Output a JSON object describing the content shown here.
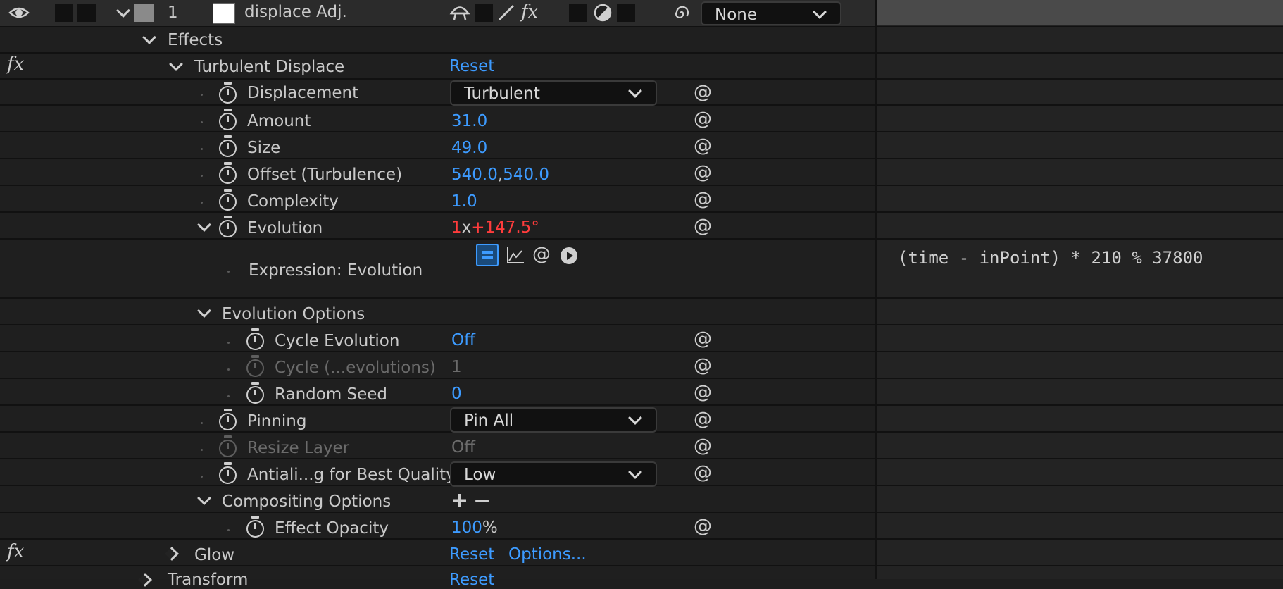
{
  "layer": {
    "number": "1",
    "name": "displace Adj.",
    "blend_mode": "None"
  },
  "effects_label": "Effects",
  "turbulent": {
    "name": "Turbulent Displace",
    "reset": "Reset"
  },
  "props": {
    "displacement": {
      "label": "Displacement",
      "value": "Turbulent"
    },
    "amount": {
      "label": "Amount",
      "value": "31.0"
    },
    "size": {
      "label": "Size",
      "value": "49.0"
    },
    "offset": {
      "label": "Offset (Turbulence)",
      "value_x": "540.0",
      "sep": ",",
      "value_y": "540.0"
    },
    "complexity": {
      "label": "Complexity",
      "value": "1.0"
    },
    "evolution": {
      "label": "Evolution",
      "revs": "1",
      "x": "x",
      "deg": "+147.5",
      "unit": "°"
    },
    "expression": {
      "label": "Expression: Evolution",
      "code": "(time - inPoint) * 210 % 37800"
    },
    "evolution_options": "Evolution Options",
    "cycle_evolution": {
      "label": "Cycle Evolution",
      "value": "Off"
    },
    "cycle_revs": {
      "label": "Cycle (...evolutions)",
      "value": "1"
    },
    "random_seed": {
      "label": "Random Seed",
      "value": "0"
    },
    "pinning": {
      "label": "Pinning",
      "value": "Pin All"
    },
    "resize_layer": {
      "label": "Resize Layer",
      "value": "Off"
    },
    "antialias": {
      "label": "Antiali...g for Best Quality",
      "value": "Low"
    },
    "compositing": {
      "label": "Compositing Options",
      "plus": "+",
      "minus": "−"
    },
    "effect_opacity": {
      "label": "Effect Opacity",
      "value": "100",
      "unit": "%"
    }
  },
  "glow": {
    "name": "Glow",
    "reset": "Reset",
    "options": "Options..."
  },
  "transform": {
    "name": "Transform",
    "reset": "Reset"
  },
  "icons": {
    "fx": "fx",
    "eye": "eye-icon",
    "spiral": "pick-whip-icon",
    "stopwatch": "stopwatch-icon"
  }
}
